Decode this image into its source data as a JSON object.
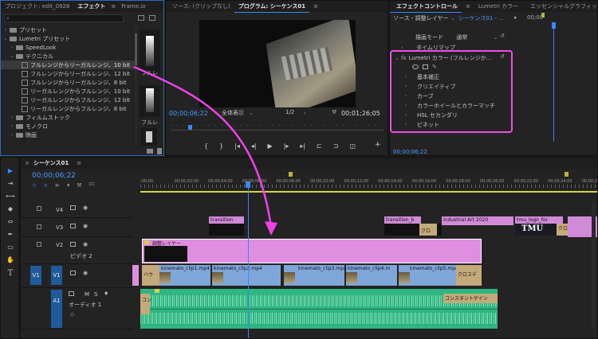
{
  "project_panel": {
    "tabs": [
      "プロジェクト: edit_0928",
      "エフェクト",
      "Frame.io"
    ],
    "tree": [
      {
        "label": "プリセット",
        "depth": 0,
        "type": "folder",
        "open": false
      },
      {
        "label": "Lumetri プリセット",
        "depth": 0,
        "type": "folder",
        "open": true
      },
      {
        "label": "SpeedLook",
        "depth": 1,
        "type": "folder",
        "open": false
      },
      {
        "label": "テクニカル",
        "depth": 1,
        "type": "folder",
        "open": true
      },
      {
        "label": "フルレンジからリーガルレンジ、10 bit",
        "depth": 2,
        "type": "item",
        "selected": true
      },
      {
        "label": "フルレンジからリーガルレンジ、12 bit",
        "depth": 2,
        "type": "item"
      },
      {
        "label": "フルレンジからリーガルレンジ、8 bit",
        "depth": 2,
        "type": "item"
      },
      {
        "label": "リーガルレンジからフルレンジ、10 bit",
        "depth": 2,
        "type": "item"
      },
      {
        "label": "リーガルレンジからフルレンジ、12 bit",
        "depth": 2,
        "type": "item"
      },
      {
        "label": "リーガルレンジからフルレンジ、8 bit",
        "depth": 2,
        "type": "item"
      },
      {
        "label": "フィルムストック",
        "depth": 1,
        "type": "folder",
        "open": false
      },
      {
        "label": "モノクロ",
        "depth": 1,
        "type": "folder",
        "open": false
      },
      {
        "label": "映画",
        "depth": 1,
        "type": "folder",
        "open": false
      }
    ],
    "preview_label_1": "フルレ",
    "preview_label_2": "フルレ"
  },
  "program_monitor": {
    "tabs": [
      "ソース: (クリップなし)",
      "プログラム: シーケンス01"
    ],
    "timecode_left": "00;00;06;22",
    "view_mode": "全体表示",
    "resolution": "1/2",
    "timecode_right": "00;01;26;05"
  },
  "effect_controls": {
    "tabs": [
      "エフェクトコントロール",
      "Lumetri カラー",
      "エッセンシャルグラフィックス"
    ],
    "source_label": "ソース・調整レイヤー",
    "sequence_label": "シーケンス01・...",
    "blend_mode_label": "描画モード",
    "blend_mode_value": "通常",
    "time_remap_label": "タイムリマップ",
    "timeline_time": "00;00",
    "fx_name": "Lumetri カラー (フルレンジか...",
    "sections": [
      "基本補正",
      "クリエイティブ",
      "カーブ",
      "カラーホイールとカラーマッチ",
      "HSL セカンダリ",
      "ビネット"
    ],
    "bottom_timecode": "00;00;06;22"
  },
  "timeline": {
    "tab": "シーケンス01",
    "timecode": "00;00;06;22",
    "ruler_labels": [
      ":00;00",
      "00;00;02;00",
      "00;00;04;00",
      "00;00;06;00",
      "00;00;08;00",
      "00;00;10;00",
      "00;00;12;00",
      "00;00;14;00",
      "00;00;16;00",
      "00;00;18;00",
      "00;00;20;00",
      "00;00;22;00",
      "00;00;24;00",
      "00;00;2"
    ],
    "tracks": {
      "v4": "V4",
      "v3": "V3",
      "v2": "V2",
      "v2_name": "ビデオ 2",
      "v1": "V1",
      "v1_src": "V1",
      "a1": "A1",
      "a1_name": "オーディオ 1",
      "m": "M",
      "s": "S"
    },
    "clips": {
      "v4_transition_1": "transition",
      "v4_transition_2": "transition_b",
      "v4_industrial": "Industrial Art 2020",
      "v4_logo": "tmu_logo_for",
      "v3_cross": "クロ",
      "v3_logo_text": "TMU",
      "v3_cross2": "クロ",
      "v2_adjust": "調整レイヤー",
      "v1_a": "ハウ",
      "v1_clip1": "kinemato_clip1.mp4",
      "v1_clip2": "kinemato_clip2.mp4",
      "v1_clip3": "kinemato_clip3.mp4",
      "v1_clip4": "kinemato_clip4.m",
      "v1_clip5": "kinemato_clip5.mp4",
      "v1_cross": "クロスデ",
      "a1_left": "コン",
      "a1_right": "コンスタントゲイン"
    }
  }
}
